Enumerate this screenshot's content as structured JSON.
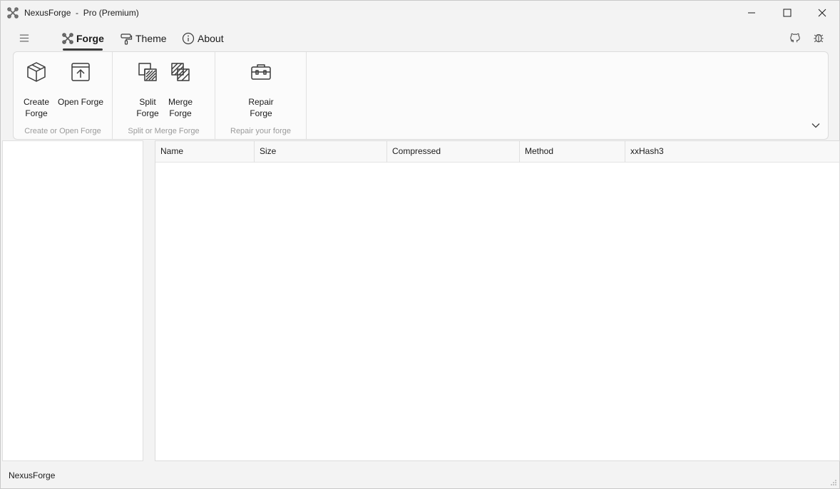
{
  "window": {
    "title": "NexusForge  -  Pro (Premium)"
  },
  "nav": {
    "tabs": [
      {
        "label": "Forge",
        "icon": "forge-icon"
      },
      {
        "label": "Theme",
        "icon": "paint-roller-icon"
      },
      {
        "label": "About",
        "icon": "info-icon"
      }
    ],
    "right_icons": [
      "github-icon",
      "bug-icon"
    ]
  },
  "ribbon": {
    "groups": [
      {
        "label": "Create or Open Forge",
        "buttons": [
          {
            "label": "Create Forge",
            "icon": "box-icon"
          },
          {
            "label": "Open Forge",
            "icon": "open-upload-icon"
          }
        ]
      },
      {
        "label": "Split or Merge Forge",
        "buttons": [
          {
            "label": "Split Forge",
            "icon": "split-icon"
          },
          {
            "label": "Merge Forge",
            "icon": "merge-icon"
          }
        ]
      },
      {
        "label": "Repair your forge",
        "buttons": [
          {
            "label": "Repair Forge",
            "icon": "toolbox-icon"
          }
        ]
      }
    ]
  },
  "table": {
    "columns": [
      "Name",
      "Size",
      "Compressed",
      "Method",
      "xxHash3"
    ],
    "rows": []
  },
  "status": {
    "text": "NexusForge"
  },
  "colors": {
    "background": "#f3f3f3",
    "ribbon": "#fbfbfb",
    "panel": "#ffffff",
    "group_label": "#9a9a9a"
  }
}
